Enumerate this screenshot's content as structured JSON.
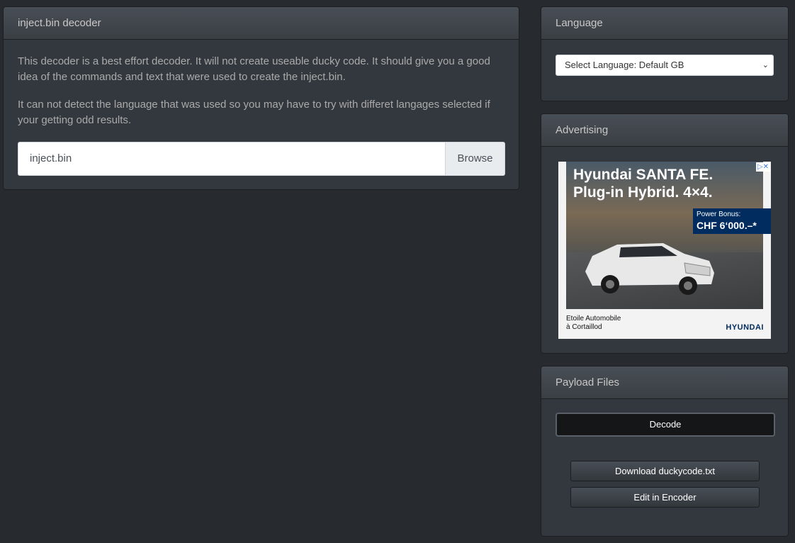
{
  "decoder": {
    "title": "inject.bin decoder",
    "para1": "This decoder is a best effort decoder. It will not create useable ducky code. It should give you a good idea of the commands and text that were used to create the inject.bin.",
    "para2": "It can not detect the language that was used so you may have to try with differet langages selected if your getting odd results.",
    "file_value": "inject.bin",
    "browse_label": "Browse"
  },
  "language": {
    "title": "Language",
    "selected": "Select Language: Default GB"
  },
  "advertising": {
    "title": "Advertising",
    "ad": {
      "headline_1": "Hyundai SANTA FE.",
      "headline_2": "Plug-in Hybrid. 4×4.",
      "bonus_label": "Power Bonus:",
      "bonus_value": "CHF 6‘000.–*",
      "dealer_1": "Etoile Automobile",
      "dealer_2": "à Cortaillod",
      "brand": "HYUNDAI"
    }
  },
  "payload": {
    "title": "Payload Files",
    "decode_label": "Decode",
    "download_label": "Download duckycode.txt",
    "edit_label": "Edit in Encoder"
  },
  "colors": {
    "page_bg": "#272b30",
    "panel_bg": "#32383e",
    "heading_bg": "#3e444c",
    "ad_brand": "#002c5f"
  }
}
